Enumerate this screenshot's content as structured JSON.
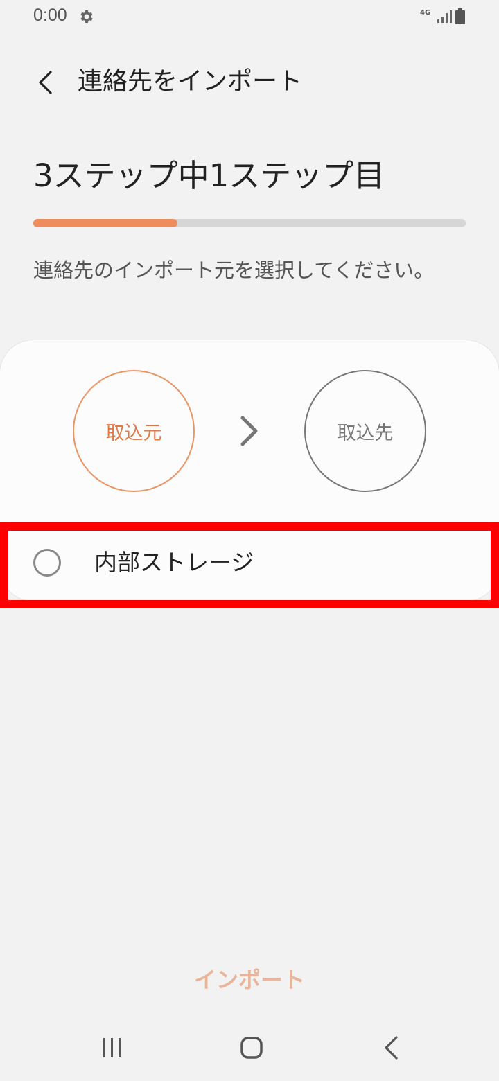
{
  "status_bar": {
    "time": "0:00",
    "network": "4G",
    "icons": [
      "gear-icon",
      "signal-icon",
      "battery-icon"
    ]
  },
  "app_bar": {
    "title": "連絡先をインポート",
    "back_icon": "chevron-left-icon"
  },
  "step": {
    "title": "3ステップ中1ステップ目",
    "progress_fraction": 0.333
  },
  "instruction": "連絡先のインポート元を選択してください。",
  "flow": {
    "source_label": "取込元",
    "target_label": "取込先"
  },
  "options": [
    {
      "label": "内部ストレージ",
      "selected": false
    }
  ],
  "import_button_label": "インポート",
  "colors": {
    "accent": "#ef8c5d",
    "accent_text": "#e07a45",
    "disabled_button": "#e8b49a",
    "highlight": "#ff0000",
    "background": "#f2f2f2",
    "card": "#fcfcfc"
  }
}
